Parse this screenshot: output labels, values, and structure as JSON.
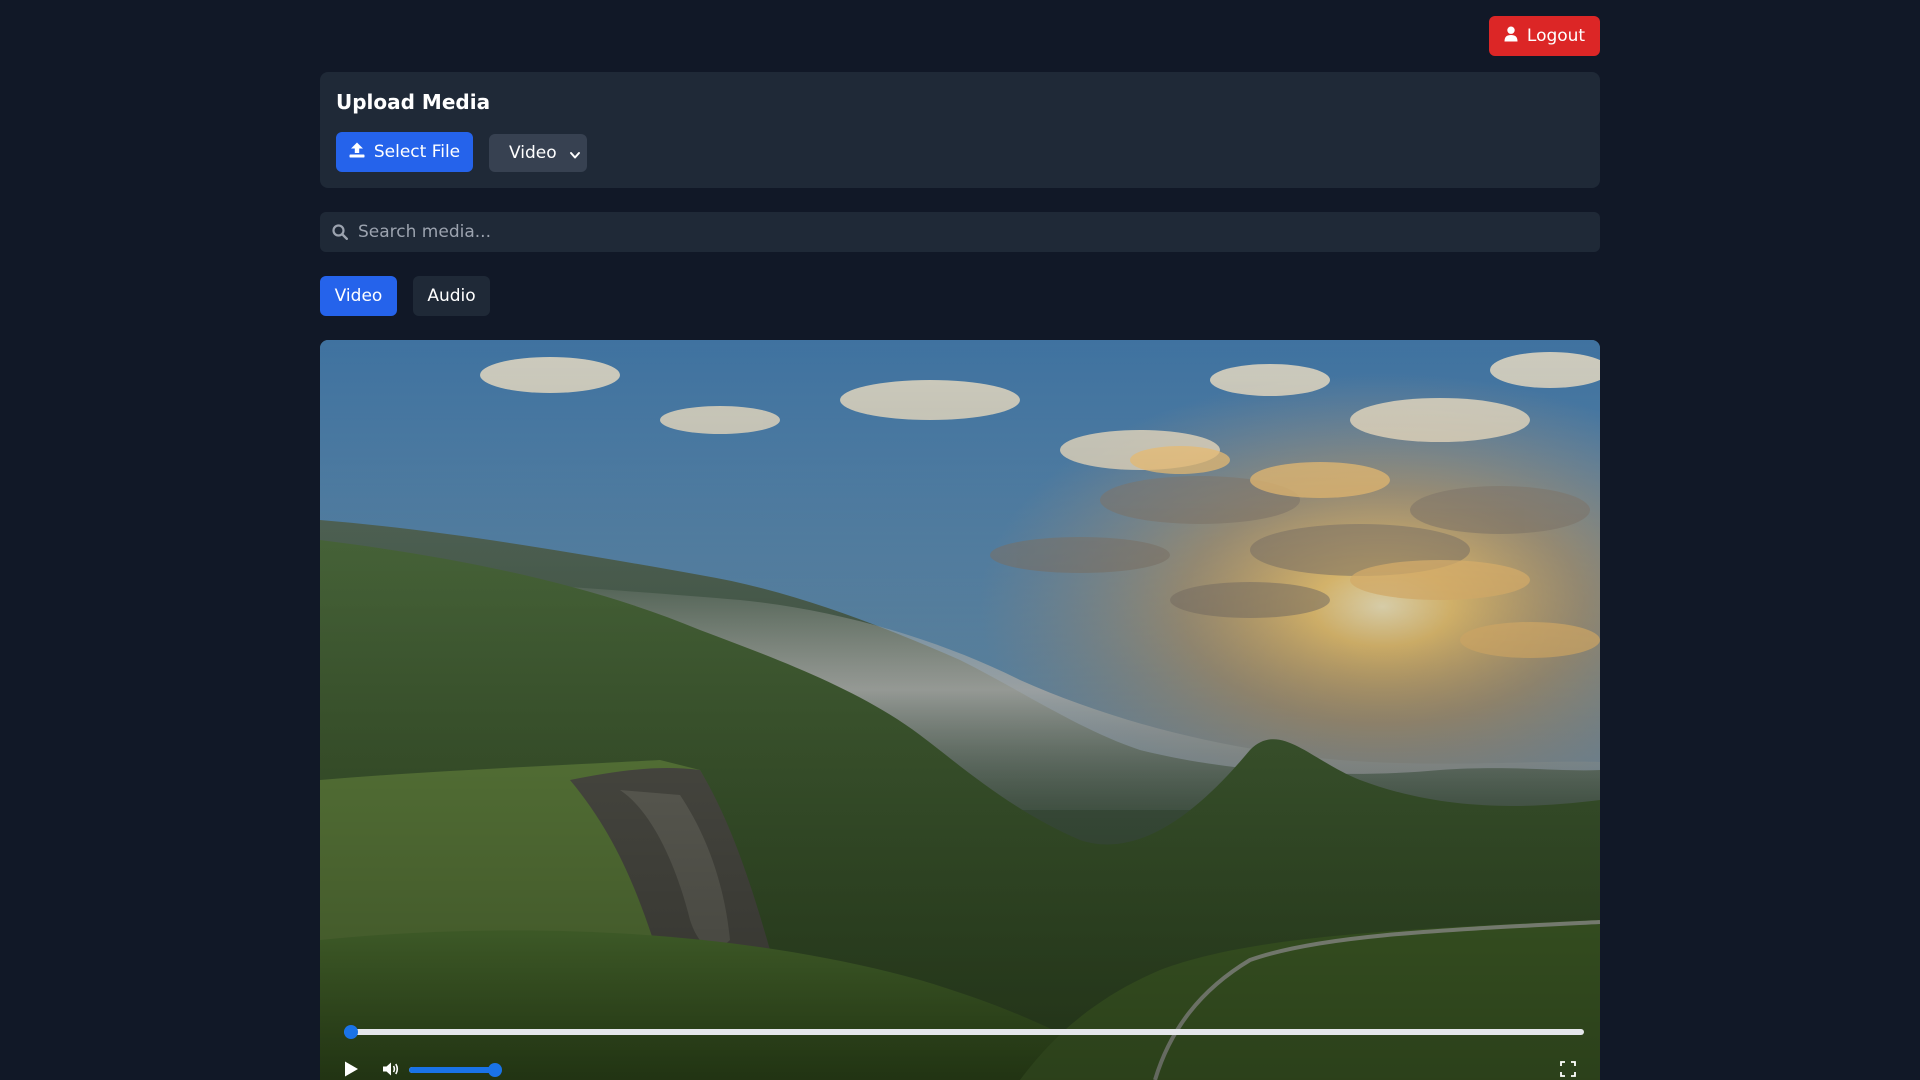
{
  "header": {
    "logout_label": "Logout"
  },
  "upload": {
    "title": "Upload Media",
    "select_file_label": "Select File",
    "type_selected": "Video"
  },
  "search": {
    "placeholder": "Search media...",
    "value": ""
  },
  "tabs": [
    {
      "label": "Video",
      "active": true
    },
    {
      "label": "Audio",
      "active": false
    }
  ],
  "player": {
    "progress": 0.0,
    "volume": 1.0,
    "icons": [
      "play-icon",
      "volume-icon",
      "fullscreen-icon"
    ]
  },
  "colors": {
    "page_bg": "#111827",
    "card_bg": "#1f2937",
    "accent": "#2563eb",
    "danger": "#dc2626",
    "slider": "#1a73e8"
  }
}
